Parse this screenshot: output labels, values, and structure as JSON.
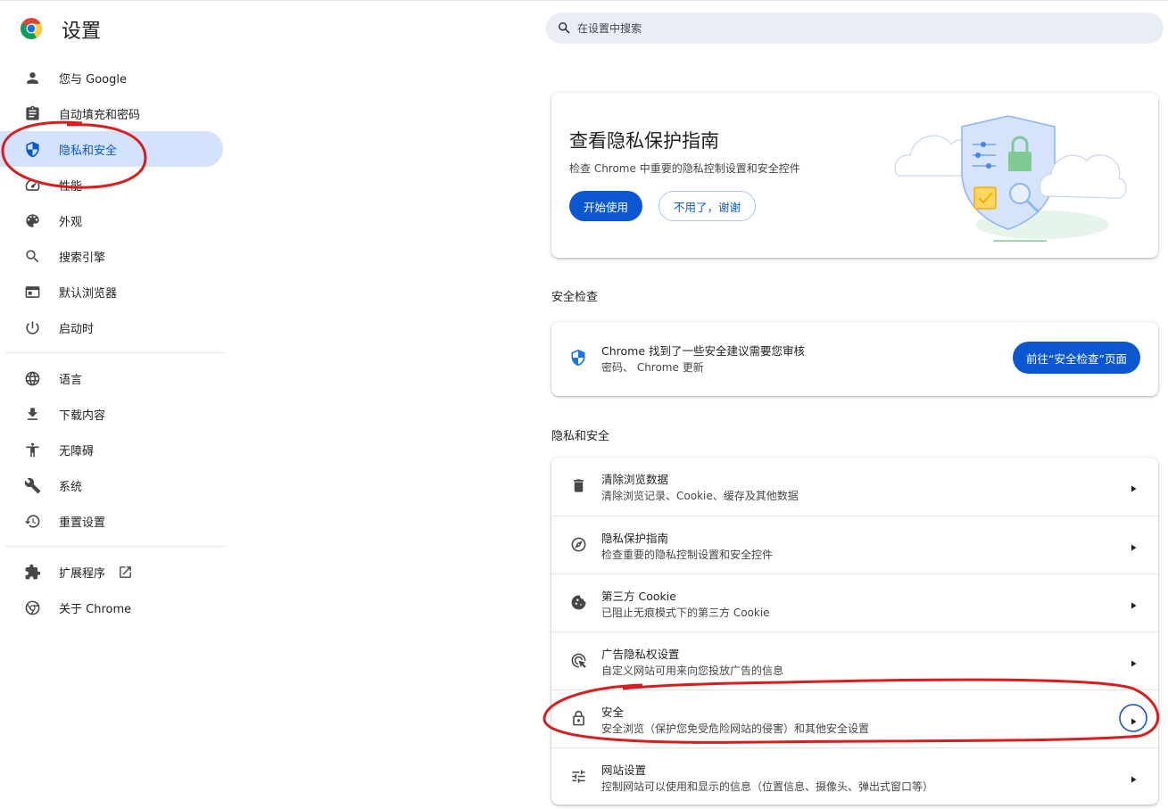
{
  "header": {
    "title": "设置",
    "search_placeholder": "在设置中搜索"
  },
  "sidebar": {
    "items": [
      {
        "label": "您与 Google",
        "icon": "person-icon"
      },
      {
        "label": "自动填充和密码",
        "icon": "clipboard-icon"
      },
      {
        "label": "隐私和安全",
        "icon": "shield-icon",
        "active": true
      },
      {
        "label": "性能",
        "icon": "speedometer-icon"
      },
      {
        "label": "外观",
        "icon": "palette-icon"
      },
      {
        "label": "搜索引擎",
        "icon": "search-icon"
      },
      {
        "label": "默认浏览器",
        "icon": "browser-window-icon"
      },
      {
        "label": "启动时",
        "icon": "power-icon"
      },
      {
        "label": "语言",
        "icon": "globe-icon"
      },
      {
        "label": "下载内容",
        "icon": "download-icon"
      },
      {
        "label": "无障碍",
        "icon": "accessibility-icon"
      },
      {
        "label": "系统",
        "icon": "wrench-icon"
      },
      {
        "label": "重置设置",
        "icon": "history-icon"
      },
      {
        "label": "扩展程序",
        "icon": "puzzle-icon"
      },
      {
        "label": "关于 Chrome",
        "icon": "chrome-icon"
      }
    ]
  },
  "promo": {
    "title": "查看隐私保护指南",
    "description": "检查 Chrome 中重要的隐私控制设置和安全控件",
    "primary_button": "开始使用",
    "secondary_button": "不用了，谢谢"
  },
  "safety_check": {
    "section_title": "安全检查",
    "line1": "Chrome 找到了一些安全建议需要您审核",
    "line2": "密码、 Chrome 更新",
    "button": "前往“安全检查”页面"
  },
  "privacy": {
    "section_title": "隐私和安全",
    "rows": [
      {
        "title": "清除浏览数据",
        "subtitle": "清除浏览记录、Cookie、缓存及其他数据",
        "icon": "trash-icon"
      },
      {
        "title": "隐私保护指南",
        "subtitle": "检查重要的隐私控制设置和安全控件",
        "icon": "compass-icon"
      },
      {
        "title": "第三方 Cookie",
        "subtitle": "已阻止无痕模式下的第三方 Cookie",
        "icon": "cookie-icon"
      },
      {
        "title": "广告隐私权设置",
        "subtitle": "自定义网站可用来向您投放广告的信息",
        "icon": "ads-click-icon"
      },
      {
        "title": "安全",
        "subtitle": "安全浏览（保护您免受危险网站的侵害）和其他安全设置",
        "icon": "lock-icon"
      },
      {
        "title": "网站设置",
        "subtitle": "控制网站可以使用和显示的信息（位置信息、摄像头、弹出式窗口等）",
        "icon": "tune-icon"
      }
    ]
  },
  "colors": {
    "accent": "#0b57d0",
    "active_bg": "#d3e3fd",
    "search_bg": "#e9eef6",
    "annotation": "#d91c1c"
  }
}
